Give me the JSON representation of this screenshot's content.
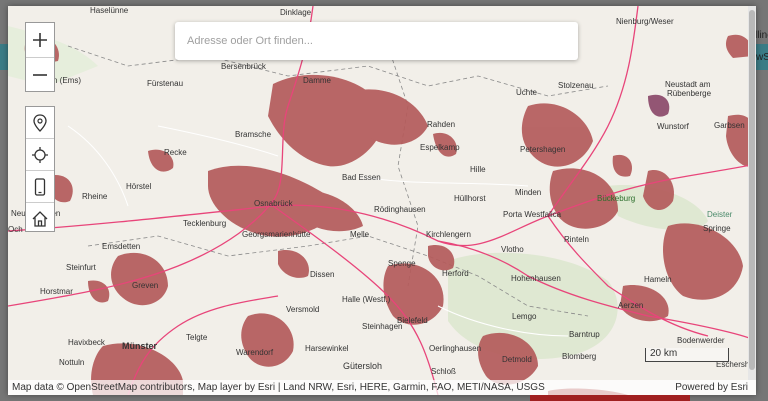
{
  "search": {
    "placeholder": "Adresse oder Ort finden..."
  },
  "attribution": {
    "left": "Map data © OpenStreetMap contributors, Map layer by Esri | Land NRW, Esri, HERE, Garmin, FAO, METI/NASA, USGS",
    "right": "Powered by Esri"
  },
  "scale": {
    "label": "20 km"
  },
  "edge": {
    "right_top": "lline",
    "right_mid": "wS"
  },
  "icons": {
    "zoom_in": "plus-icon",
    "zoom_out": "minus-icon",
    "marker": "map-marker-icon",
    "locate": "crosshair-icon",
    "mobile": "mobile-phone-icon",
    "home": "home-icon"
  },
  "colors": {
    "map_bg": "#f2efe9",
    "urban": "#b45b5b",
    "road_major": "#e8457a",
    "road_minor": "#ffffff",
    "boundary": "#8a8a8a",
    "forest": "#dfe8d2",
    "water": "#aad3df"
  },
  "places": [
    {
      "id": "haselunne",
      "label": "Haselünne"
    },
    {
      "id": "dinklage",
      "label": "Dinklage"
    },
    {
      "id": "nienburg",
      "label": "Nienburg/Weser"
    },
    {
      "id": "bersenbruck",
      "label": "Bersenbrück"
    },
    {
      "id": "ems",
      "label": "n (Ems)"
    },
    {
      "id": "furstenau",
      "label": "Fürstenau"
    },
    {
      "id": "damme",
      "label": "Damme"
    },
    {
      "id": "uchte",
      "label": "Uchte"
    },
    {
      "id": "stolzenau",
      "label": "Stolzenau"
    },
    {
      "id": "neustadt1",
      "label": "Neustadt am"
    },
    {
      "id": "neustadt2",
      "label": "Rübenberge"
    },
    {
      "id": "rahden",
      "label": "Rahden"
    },
    {
      "id": "wunstorf",
      "label": "Wunstorf"
    },
    {
      "id": "garbsen",
      "label": "Garbsen"
    },
    {
      "id": "bramsche",
      "label": "Bramsche"
    },
    {
      "id": "espelkamp",
      "label": "Espelkamp"
    },
    {
      "id": "petershagen",
      "label": "Petershagen"
    },
    {
      "id": "recke",
      "label": "Recke"
    },
    {
      "id": "hille",
      "label": "Hille"
    },
    {
      "id": "badessen",
      "label": "Bad Essen"
    },
    {
      "id": "horstel",
      "label": "Hörstel"
    },
    {
      "id": "minden",
      "label": "Minden"
    },
    {
      "id": "rheine",
      "label": "Rheine"
    },
    {
      "id": "osnabruck",
      "label": "Osnabrück"
    },
    {
      "id": "hullhorst",
      "label": "Hüllhorst"
    },
    {
      "id": "buckeburg",
      "label": "Bückeburg"
    },
    {
      "id": "neuenkirchen",
      "label": "Neuenkirchen"
    },
    {
      "id": "tecklenburg",
      "label": "Tecklenburg"
    },
    {
      "id": "rodinghausen",
      "label": "Rödinghausen"
    },
    {
      "id": "portawest",
      "label": "Porta Westfalica"
    },
    {
      "id": "deister",
      "label": "Deister"
    },
    {
      "id": "och",
      "label": "Och"
    },
    {
      "id": "georgsmarienhutte",
      "label": "Georgsmarienhütte"
    },
    {
      "id": "melle",
      "label": "Melle"
    },
    {
      "id": "kirchlengern",
      "label": "Kirchlengern"
    },
    {
      "id": "rinteln",
      "label": "Rinteln"
    },
    {
      "id": "springe",
      "label": "Springe"
    },
    {
      "id": "emsdetten",
      "label": "Emsdetten"
    },
    {
      "id": "vlotho",
      "label": "Vlotho"
    },
    {
      "id": "spenge",
      "label": "Spenge"
    },
    {
      "id": "steinfurt",
      "label": "Steinfurt"
    },
    {
      "id": "dissen",
      "label": "Dissen"
    },
    {
      "id": "herford",
      "label": "Herford"
    },
    {
      "id": "hohenhausen",
      "label": "Hohenhausen"
    },
    {
      "id": "hameln",
      "label": "Hameln"
    },
    {
      "id": "horstmar",
      "label": "Horstmar"
    },
    {
      "id": "greven",
      "label": "Greven"
    },
    {
      "id": "hallewestf",
      "label": "Halle (Westf.)"
    },
    {
      "id": "aerzen",
      "label": "Aerzen"
    },
    {
      "id": "versmold",
      "label": "Versmold"
    },
    {
      "id": "lemgo",
      "label": "Lemgo"
    },
    {
      "id": "steinhagen",
      "label": "Steinhagen"
    },
    {
      "id": "bielefeld",
      "label": "Bielefeld"
    },
    {
      "id": "telgte",
      "label": "Telgte"
    },
    {
      "id": "barntrup",
      "label": "Barntrup"
    },
    {
      "id": "havixbeck",
      "label": "Havixbeck"
    },
    {
      "id": "bodenwerder",
      "label": "Bodenwerder"
    },
    {
      "id": "harsewinkel",
      "label": "Harsewinkel"
    },
    {
      "id": "oerlinghausen",
      "label": "Oerlinghausen"
    },
    {
      "id": "munster",
      "label": "Münster"
    },
    {
      "id": "warendorf",
      "label": "Warendorf"
    },
    {
      "id": "detmold",
      "label": "Detmold"
    },
    {
      "id": "blomberg",
      "label": "Blomberg"
    },
    {
      "id": "eschersh",
      "label": "Eschersh"
    },
    {
      "id": "nottuln",
      "label": "Nottuln"
    },
    {
      "id": "gutersloh",
      "label": "Gütersloh"
    },
    {
      "id": "schloss",
      "label": "Schloß"
    }
  ]
}
